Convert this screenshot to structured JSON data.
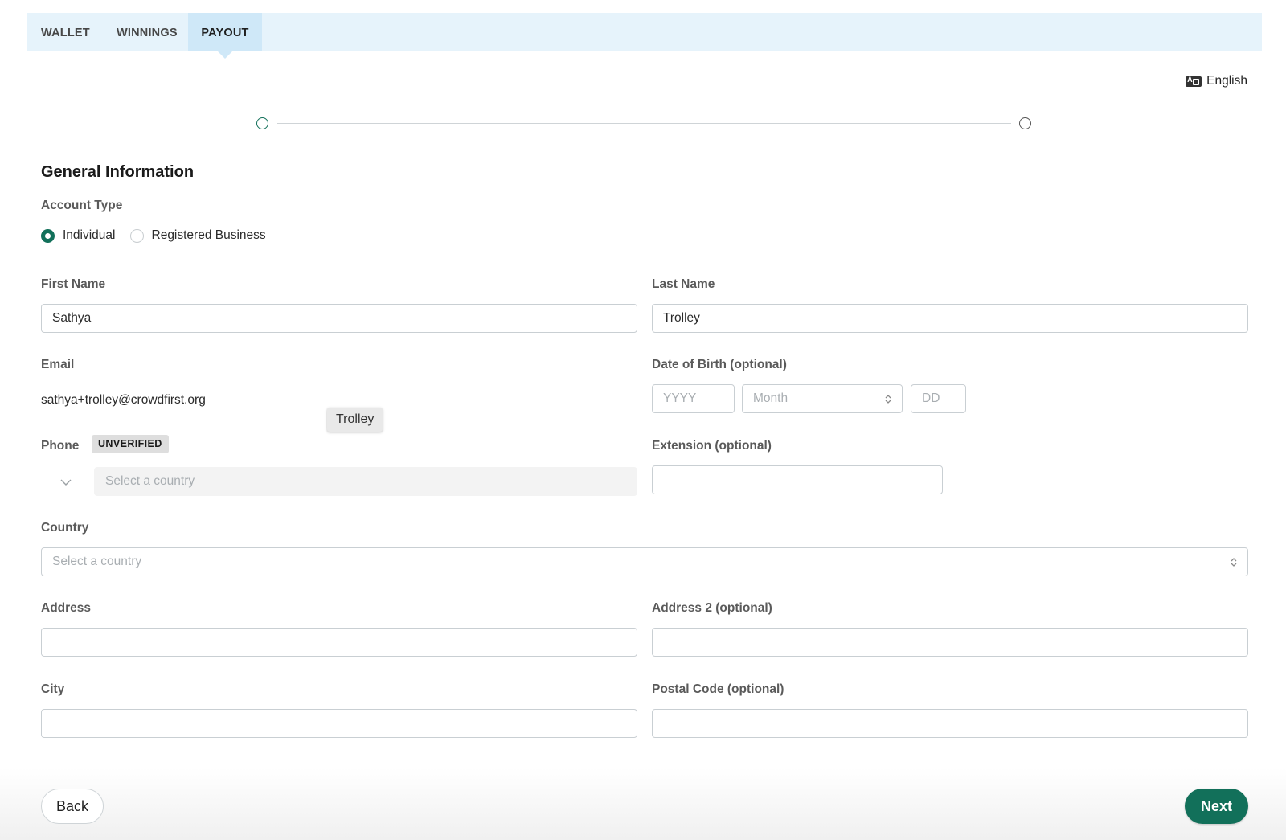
{
  "tabs": [
    {
      "label": "WALLET"
    },
    {
      "label": "WINNINGS"
    },
    {
      "label": "PAYOUT",
      "active": true
    }
  ],
  "language": {
    "label": "English",
    "icon": "language-icon"
  },
  "stepper": {
    "current_step": 1,
    "total_steps": 2
  },
  "form": {
    "section_title": "General Information",
    "account_type": {
      "label": "Account Type",
      "options": [
        "Individual",
        "Registered Business"
      ],
      "selected": "Individual"
    },
    "first_name": {
      "label": "First Name",
      "value": "Sathya"
    },
    "last_name": {
      "label": "Last Name",
      "value": "Trolley"
    },
    "email": {
      "label": "Email",
      "value": "sathya+trolley@crowdfirst.org"
    },
    "dob": {
      "label": "Date of Birth (optional)",
      "year_placeholder": "YYYY",
      "month_placeholder": "Month",
      "day_placeholder": "DD"
    },
    "phone": {
      "label": "Phone",
      "badge": "UNVERIFIED",
      "country_placeholder": "Select a country"
    },
    "extension": {
      "label": "Extension (optional)",
      "value": ""
    },
    "country": {
      "label": "Country",
      "placeholder": "Select a country"
    },
    "address": {
      "label": "Address",
      "value": ""
    },
    "address2": {
      "label": "Address 2 (optional)",
      "value": ""
    },
    "city": {
      "label": "City",
      "value": ""
    },
    "postal_code": {
      "label": "Postal Code (optional)",
      "value": ""
    }
  },
  "tooltip": {
    "text": "Trolley"
  },
  "buttons": {
    "back": "Back",
    "next": "Next"
  },
  "colors": {
    "accent": "#12705a",
    "tabbar_bg": "#e6f3fb",
    "active_tab_bg": "#cfe8f8"
  }
}
